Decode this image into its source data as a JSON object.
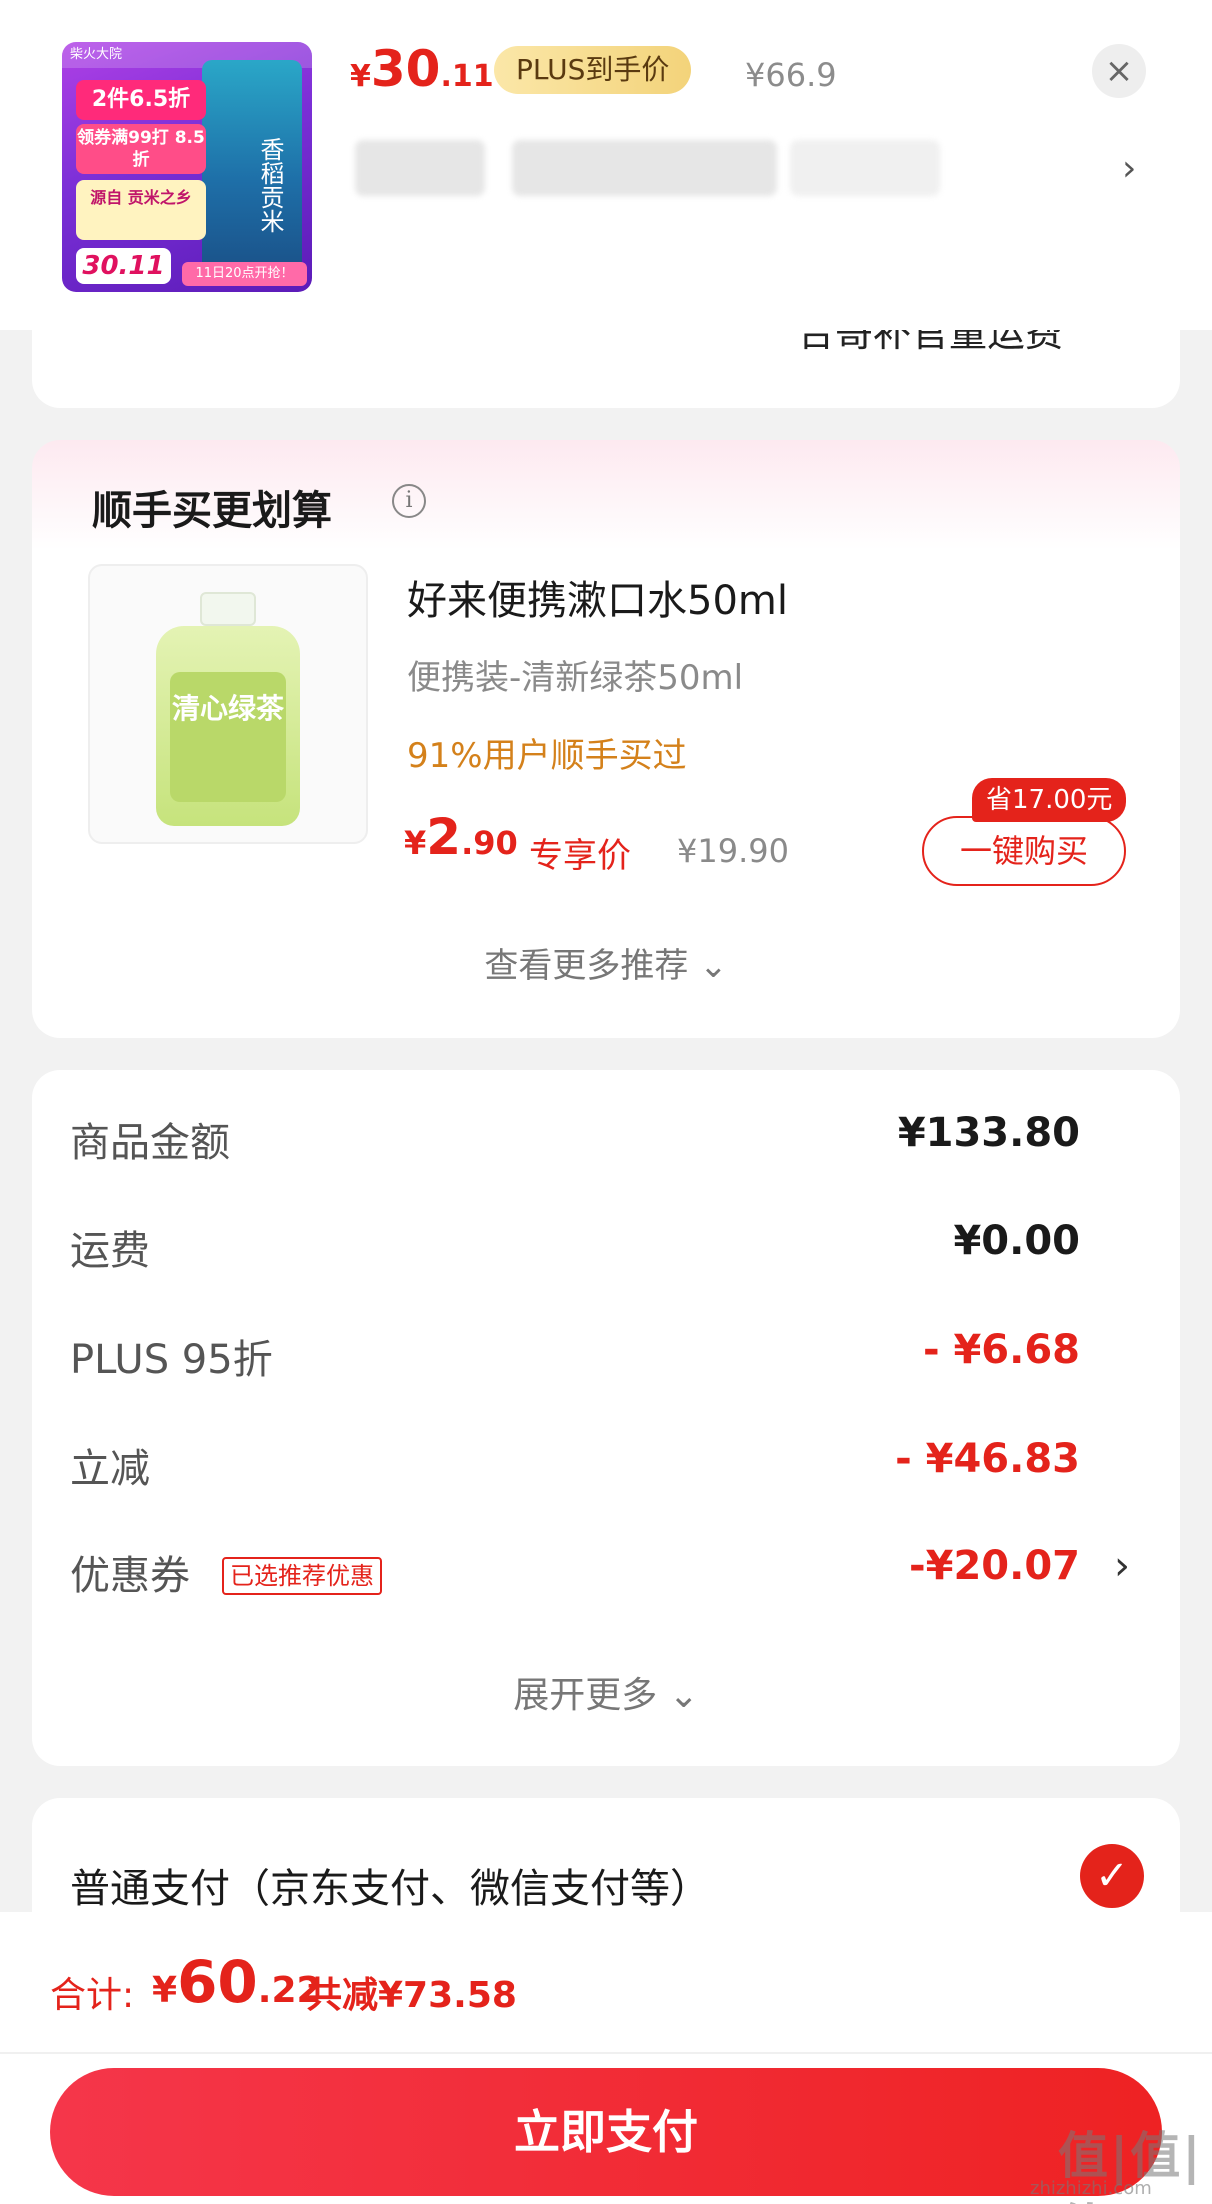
{
  "header": {
    "thumbnail": {
      "ribbon": "柴火大院",
      "tag1": "2件6.5折",
      "tag2": "领券满99打 8.5折",
      "tag3": "源自 贡米之乡",
      "price": "30.11",
      "start": "11日20点开抢！",
      "bag_text": "香稻贡米"
    },
    "price_symbol": "¥",
    "price_int": "30",
    "price_dec": ".11",
    "plus_label": "PLUS到手价",
    "original_price": "¥66.9",
    "close_icon": "×",
    "chevron": "›"
  },
  "cut_card": {
    "text": "合哥补官量运费"
  },
  "recommend": {
    "title": "顺手买更划算",
    "info_icon": "i",
    "product": {
      "label_text": "清心绿茶",
      "name": "好来便携漱口水50ml",
      "spec": "便携装-清新绿茶50ml",
      "bought": "91%用户顺手买过",
      "price_symbol": "¥",
      "price_int": "2",
      "price_dec": ".90",
      "exclusive": "专享价",
      "original": "¥19.90",
      "save_badge": "省17.00元",
      "buy_label": "一键购买"
    },
    "more_label": "查看更多推荐 ⌄"
  },
  "price_breakdown": {
    "rows": [
      {
        "label": "商品金额",
        "value": "¥133.80"
      },
      {
        "label": "运费",
        "value": "¥0.00"
      },
      {
        "label": "PLUS 95折",
        "value": "- ¥6.68"
      },
      {
        "label": "立减",
        "value": "- ¥46.83"
      },
      {
        "label": "优惠券",
        "value": "-¥20.07",
        "tag": "已选推荐优惠",
        "arrow": "›"
      }
    ],
    "expand_label": "展开更多 ⌄"
  },
  "payment": {
    "method": "普通支付（京东支付、微信支付等）",
    "check_icon": "✓"
  },
  "footer": {
    "total_label": "合计:",
    "total_symbol": "¥",
    "total_int": "60",
    "total_dec": ".22",
    "total_save": "共减¥73.58",
    "pay_button": "立即支付"
  },
  "watermark": {
    "text": "值|值|值",
    "sub": "zhizhizhi.com"
  },
  "colors": {
    "accent": "#e4231b",
    "plus_gold": "#f3d37a",
    "bought_orange": "#d4811b"
  }
}
